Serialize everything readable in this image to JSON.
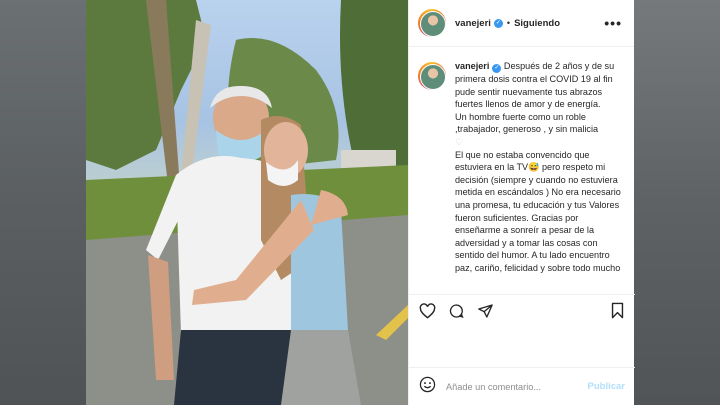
{
  "header": {
    "username": "vanejeri",
    "separator": "•",
    "follow_status": "Siguiendo",
    "more": "•••"
  },
  "caption": {
    "username": "vanejeri",
    "line1": "Después de 2 años y de su primera dosis contra el COVID 19 al fin pude sentir nuevamente tus abrazos fuertes llenos de amor y de energía.",
    "line2": "Un hombre fuerte como un roble ,trabajador, generoso , y sin malicia",
    "line3": "El que no estaba convencido que estuviera en la TV😅 pero respeto mi decisión (siempre y cuando no estuviera metida en escándalos ) No era necesario una promesa, tu educación y tus Valores fueron suficientes. Gracias por enseñarme a sonreír a pesar de la adversidad y a tomar las cosas con sentido del humor. A tu lado encuentro paz, cariño, felicidad y sobre todo mucho"
  },
  "comment": {
    "placeholder": "Añade un comentario...",
    "post_label": "Publicar"
  },
  "icons": {
    "like": "heart-icon",
    "comment": "comment-icon",
    "share": "paper-plane-icon",
    "save": "bookmark-icon",
    "emoji": "smiley-icon"
  },
  "colors": {
    "verified": "#3897f0",
    "publish_disabled": "#b2dffc",
    "text": "#262626",
    "muted": "#8e8e8e"
  }
}
